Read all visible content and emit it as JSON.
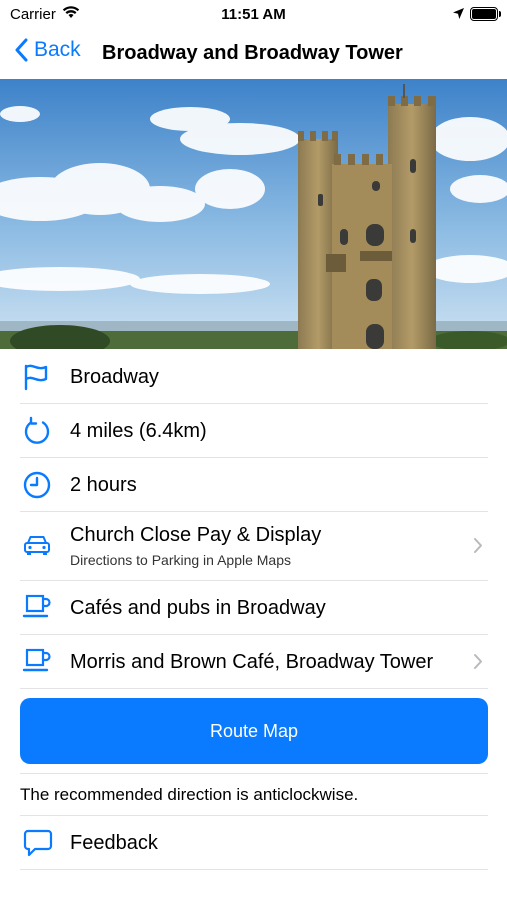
{
  "status_bar": {
    "carrier": "Carrier",
    "time": "11:51 AM",
    "icons": [
      "wifi-icon",
      "location-arrow-icon",
      "battery-icon"
    ]
  },
  "nav": {
    "back_label": "Back",
    "title": "Broadway and Broadway Tower"
  },
  "details": [
    {
      "icon": "flag-icon",
      "label": "Broadway"
    },
    {
      "icon": "circular-arrow-icon",
      "label": "4 miles (6.4km)"
    },
    {
      "icon": "clock-icon",
      "label": "2 hours"
    },
    {
      "icon": "car-icon",
      "label": "Church Close Pay & Display",
      "sublabel": "Directions to Parking in Apple Maps",
      "disclosure": true
    },
    {
      "icon": "cup-icon",
      "label": "Cafés and pubs in Broadway"
    },
    {
      "icon": "cup-icon",
      "label": "Morris and Brown Café, Broadway Tower",
      "disclosure": true
    }
  ],
  "route_map_button": "Route Map",
  "direction_note": "The recommended direction is anticlockwise.",
  "feedback": {
    "icon": "speech-bubble-icon",
    "label": "Feedback"
  },
  "colors": {
    "accent": "#0a7aff",
    "separator": "#e3e3e6"
  }
}
